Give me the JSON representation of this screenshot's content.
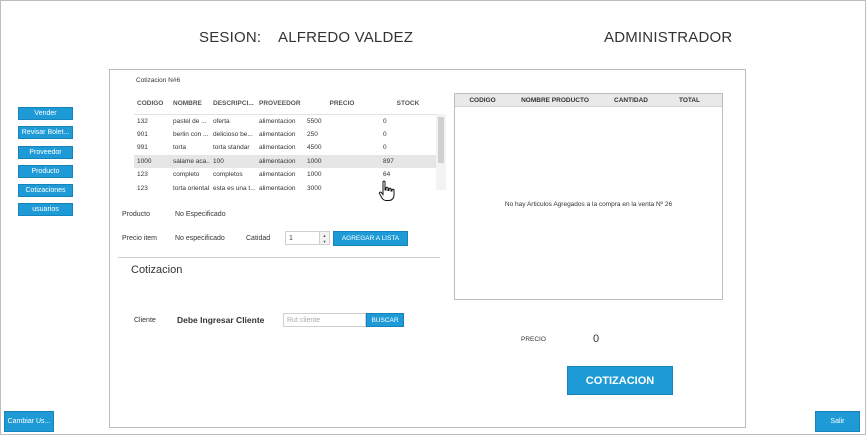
{
  "header": {
    "session_label": "SESION:",
    "user_name": "ALFREDO VALDEZ",
    "role": "ADMINISTRADOR"
  },
  "sidebar": {
    "items": [
      {
        "label": "Vender"
      },
      {
        "label": "Revisar Bolet..."
      },
      {
        "label": "Proveedor"
      },
      {
        "label": "Producto"
      },
      {
        "label": "Cotizaciones"
      },
      {
        "label": "usuarios"
      }
    ]
  },
  "footer": {
    "change_user": "Cambiar Us...",
    "exit": "Salir"
  },
  "panel": {
    "quote_number": "Cotizacion N#6",
    "products_table": {
      "columns": [
        "CODIGO",
        "NOMBRE",
        "DESCRIPCI...",
        "PROVEEDOR",
        "PRECIO",
        "STOCK"
      ],
      "rows": [
        [
          "132",
          "pastel de ...",
          "oferta",
          "alimentacion",
          "5500",
          "0"
        ],
        [
          "901",
          "berlin con ...",
          "delicioso be...",
          "alimentacion",
          "250",
          "0"
        ],
        [
          "991",
          "torta",
          "torta standar",
          "alimentacion",
          "4500",
          "0"
        ],
        [
          "1000",
          "salame aca...",
          "100",
          "alimentacion",
          "1000",
          "897"
        ],
        [
          "123",
          "completo",
          "completos",
          "alimentacion",
          "1000",
          "64"
        ],
        [
          "123",
          "torta oriental",
          "esta es una t...",
          "alimentacion",
          "3000",
          ""
        ]
      ],
      "selected_row": 3
    },
    "product_label": "Producto",
    "product_value": "No Especificado",
    "price_item_label": "Precio item",
    "price_item_value": "No especificado",
    "quantity_label": "Catidad",
    "quantity_value": "1",
    "add_button": "AGREGAR A LISTA",
    "section_title": "Cotizacion",
    "client_label": "Cliente",
    "client_value": "Debe Ingresar Cliente",
    "rut_placeholder": "Rut cliente",
    "search_button": "BUSCAR",
    "cart_table": {
      "columns": [
        "CODIGO",
        "NOMBRE PRODUCTO",
        "CANTIDAD",
        "TOTAL"
      ],
      "empty_message": "No hay Articulos Agregados a la compra en la venta Nº 26"
    },
    "price_label": "PRECIO",
    "price_value": "0",
    "quote_button": "COTIZACION"
  },
  "colors": {
    "accent": "#1e9bd7"
  }
}
